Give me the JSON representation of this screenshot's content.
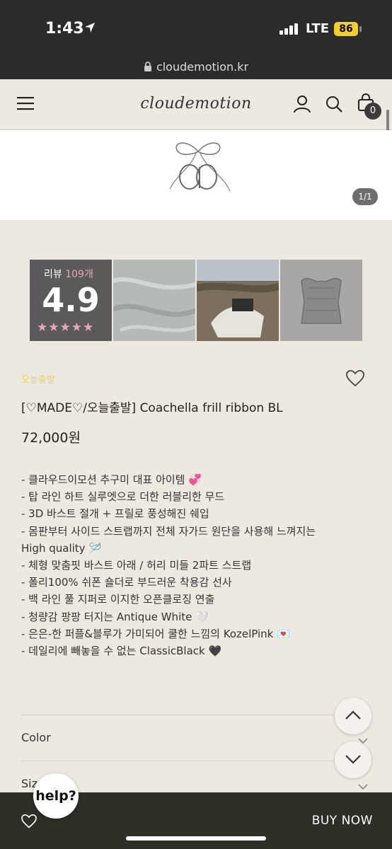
{
  "status_bar": {
    "time": "1:43",
    "network": "LTE",
    "battery": "86"
  },
  "browser": {
    "url": "cloudemotion.kr"
  },
  "header": {
    "logo": "cloudemotion",
    "cart_count": "0"
  },
  "banner": {
    "pager": "1/1"
  },
  "reviews": {
    "label": "리뷰",
    "count": "109개",
    "score": "4.9",
    "stars": "★★★★★"
  },
  "product": {
    "tag": "오늘출발",
    "title": "[♡MADE♡/오늘출발] Coachella frill ribbon BL",
    "price": "72,000원",
    "description": [
      "- 클라우드이모션 추구미 대표 아이템 💞",
      "- 탑 라인 하트 실루엣으로 더한 러블리한 무드",
      "- 3D 바스트 절개 + 프릴로 풍성해진 쉐입",
      "- 몸판부터 사이드 스트랩까지 전체 자가드 원단을 사용해 느껴지는",
      "High quality 🪡",
      "- 체형 맞춤핏 바스트 아래 / 허리 미들 2파트 스트랩",
      "- 폴리100% 쉬폰 숄더로 부드러운 착용감 선사",
      "- 백 라인 풀 지퍼로 이지한 오픈클로징 연출",
      "- 청량감 팡팡 터지는 Antique White 🤍",
      "- 은은-한 퍼플&블루가 가미되어 쿨한 느낌의 KozelPink 💌",
      "- 데일리에 빼놓을 수 없는 ClassicBlack 🖤"
    ]
  },
  "options": {
    "color_label": "Color",
    "size_label": "Size"
  },
  "bottom_bar": {
    "buy_label": "BUY NOW"
  },
  "help": {
    "label": "help?"
  }
}
